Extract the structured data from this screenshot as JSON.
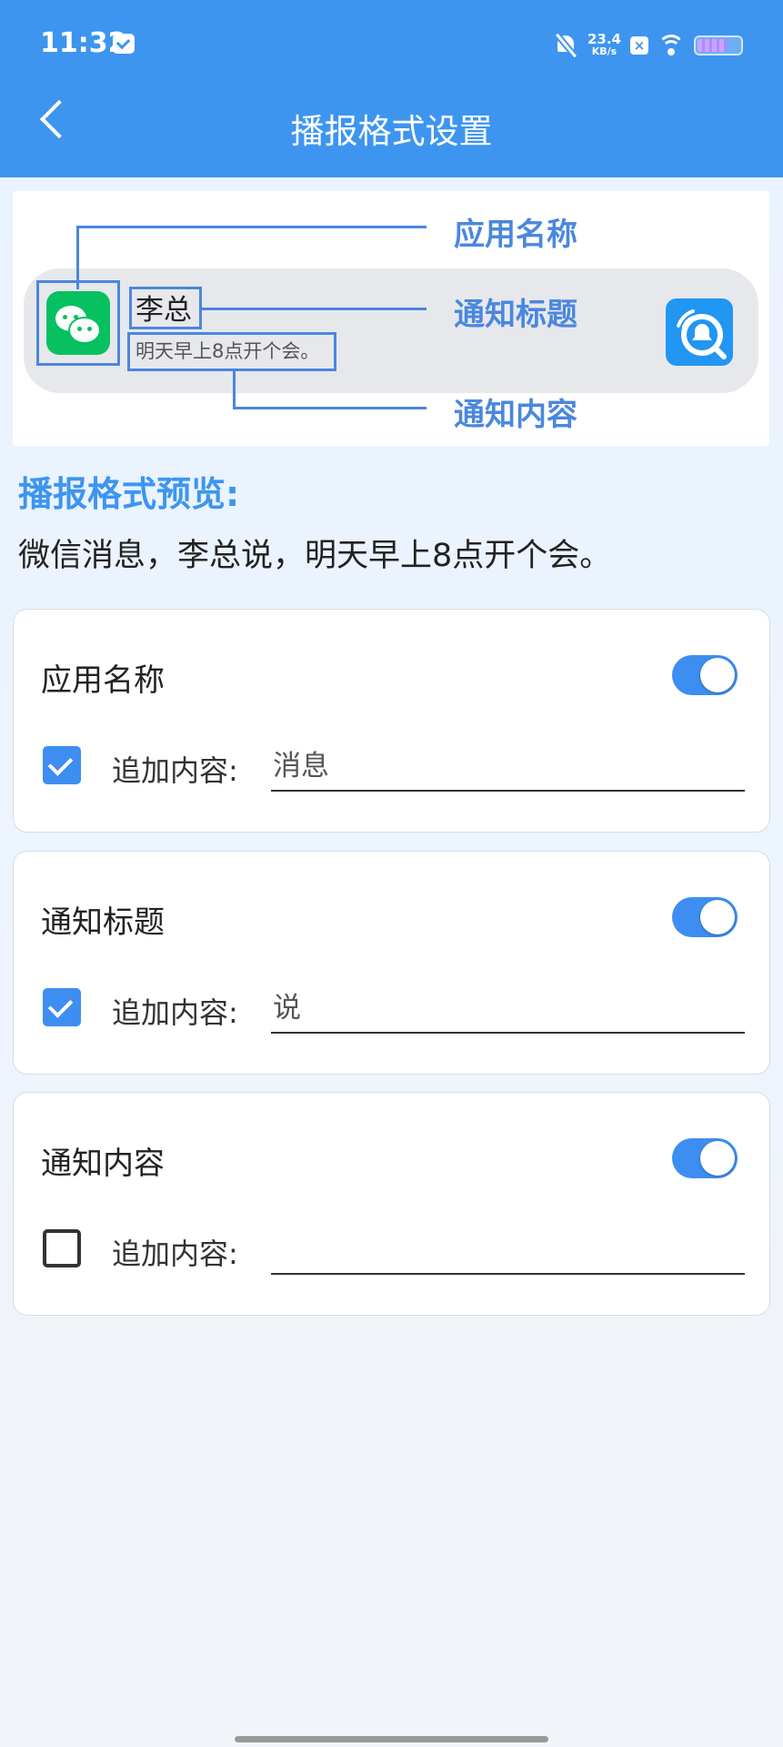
{
  "status_bar": {
    "time": "11:32",
    "net_speed_value": "23.4",
    "net_speed_unit": "KB/s",
    "x_badge": "×"
  },
  "header": {
    "title": "播报格式设置"
  },
  "diagram": {
    "notif_title": "李总",
    "notif_body": "明天早上8点开个会。",
    "label_app_name": "应用名称",
    "label_notif_title": "通知标题",
    "label_notif_content": "通知内容"
  },
  "preview": {
    "title": "播报格式预览:",
    "text": "微信消息，李总说，明天早上8点开个会。"
  },
  "cards": [
    {
      "title": "应用名称",
      "toggle_on": true,
      "checked": true,
      "append_label": "追加内容:",
      "append_value": "消息"
    },
    {
      "title": "通知标题",
      "toggle_on": true,
      "checked": true,
      "append_label": "追加内容:",
      "append_value": "说"
    },
    {
      "title": "通知内容",
      "toggle_on": true,
      "checked": false,
      "append_label": "追加内容:",
      "append_value": ""
    }
  ],
  "colors": {
    "header_bg": "#3d95f0",
    "accent": "#3d8ef0",
    "diagram_blue": "#4a87df",
    "wechat_green": "#07c160"
  }
}
